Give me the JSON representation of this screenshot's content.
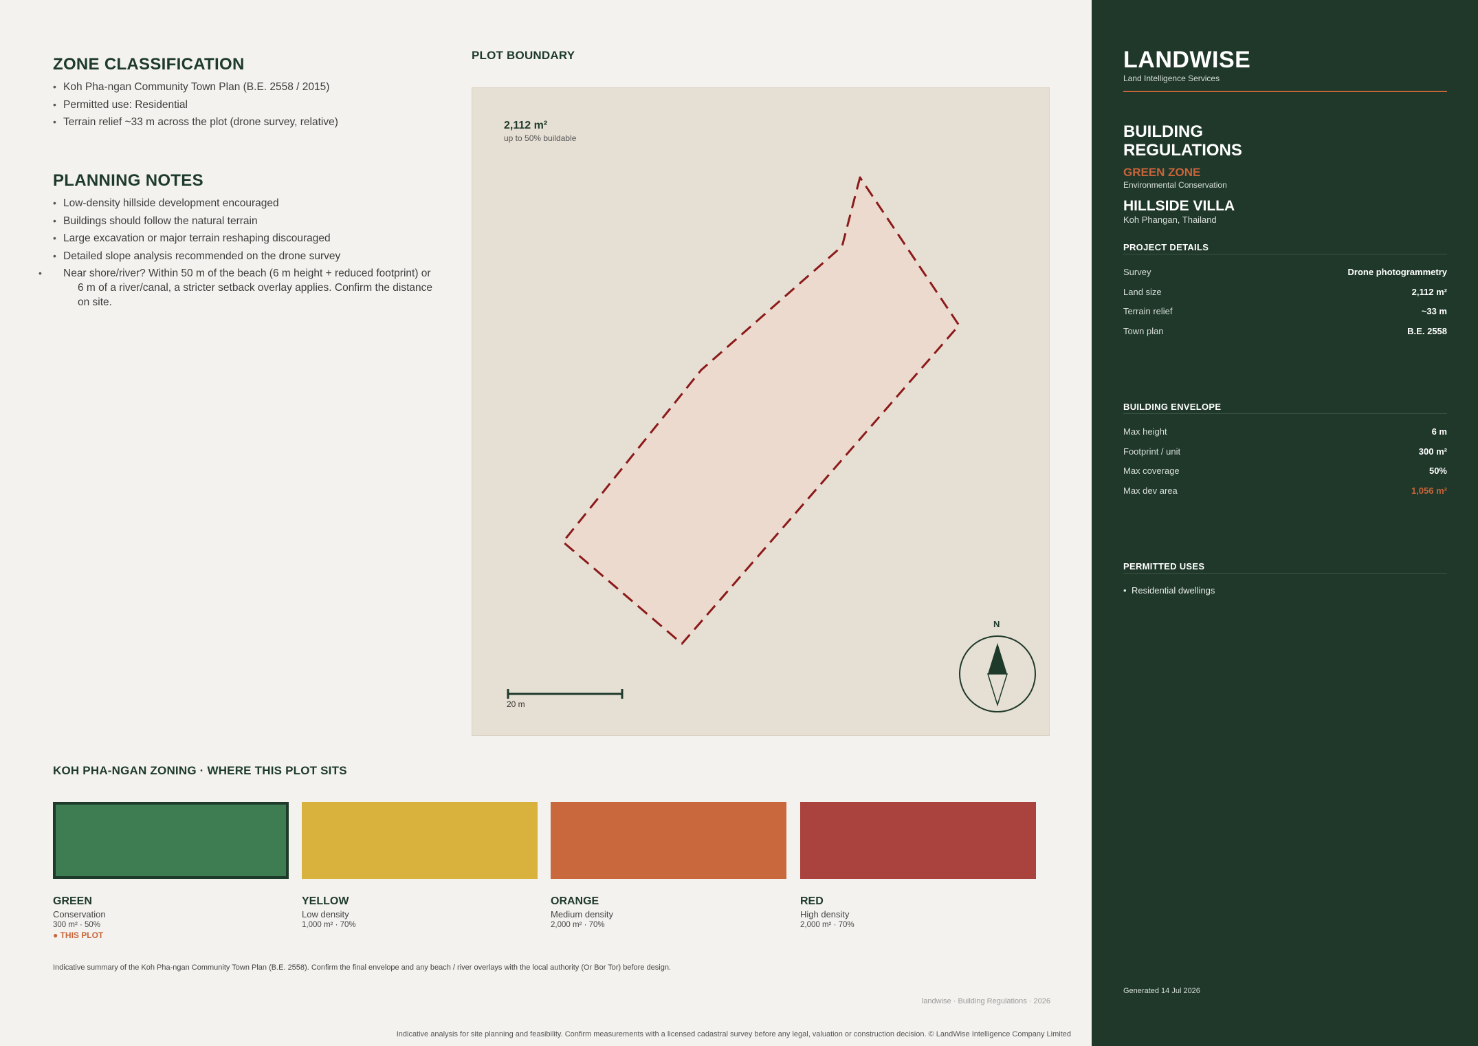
{
  "zone_classification": {
    "title": "ZONE CLASSIFICATION",
    "items": [
      "Koh Pha-ngan Community Town Plan (B.E. 2558 / 2015)",
      "Permitted use: Residential",
      "Terrain relief ~33 m across the plot (drone survey, relative)"
    ]
  },
  "planning_notes": {
    "title": "PLANNING NOTES",
    "items": [
      "Low-density hillside development encouraged",
      "Buildings should follow the natural terrain",
      "Large excavation or major terrain reshaping discouraged",
      "Detailed slope analysis recommended on the drone survey",
      "Near shore/river? Within 50 m of the beach (6 m height + reduced footprint) or 6 m of a river/canal, a stricter setback overlay applies. Confirm the distance on site."
    ]
  },
  "plot": {
    "heading": "PLOT BOUNDARY",
    "area": "2,112 m²",
    "area_sub": "up to 50% buildable",
    "north": "N",
    "scale": "20 m",
    "boundary_color": "#8b1a1a",
    "fill_color": "#ecd9cd"
  },
  "zoning": {
    "heading": "KOH PHA-NGAN ZONING · WHERE THIS PLOT SITS",
    "zones": [
      {
        "name": "GREEN",
        "desc": "Conservation",
        "spec": "300 m² · 50%",
        "tag": "● THIS PLOT",
        "color": "#3e7d52",
        "selected": true
      },
      {
        "name": "YELLOW",
        "desc": "Low density",
        "spec": "1,000 m² · 70%",
        "tag": "",
        "color": "#d8b23c",
        "selected": false
      },
      {
        "name": "ORANGE",
        "desc": "Medium density",
        "spec": "2,000 m² · 70%",
        "tag": "",
        "color": "#c8683c",
        "selected": false
      },
      {
        "name": "RED",
        "desc": "High density",
        "spec": "2,000 m² · 70%",
        "tag": "",
        "color": "#aa423d",
        "selected": false
      }
    ]
  },
  "disclaimer": "Indicative summary of the Koh Pha-ngan Community Town Plan (B.E. 2558). Confirm the final envelope and any beach / river overlays with the local authority (Or Bor Tor) before design.",
  "footer_mark": "landwise · Building Regulations · 2026",
  "legal": "Indicative analysis for site planning and feasibility. Confirm measurements with a licensed cadastral survey before any legal, valuation or construction decision. © LandWise Intelligence Company Limited",
  "sidebar": {
    "brand": "LANDWISE",
    "brand_sub": "Land Intelligence Services",
    "title_line1": "BUILDING",
    "title_line2": "REGULATIONS",
    "zone": "GREEN ZONE",
    "zone_sub": "Environmental Conservation",
    "project": "HILLSIDE VILLA",
    "location": "Koh Phangan, Thailand",
    "project_details": {
      "heading": "PROJECT DETAILS",
      "rows": [
        {
          "k": "Survey",
          "v": "Drone photogrammetry"
        },
        {
          "k": "Land size",
          "v": "2,112 m²"
        },
        {
          "k": "Terrain relief",
          "v": "~33 m"
        },
        {
          "k": "Town plan",
          "v": "B.E. 2558"
        }
      ]
    },
    "building_envelope": {
      "heading": "BUILDING ENVELOPE",
      "rows": [
        {
          "k": "Max height",
          "v": "6 m"
        },
        {
          "k": "Footprint / unit",
          "v": "300 m²"
        },
        {
          "k": "Max coverage",
          "v": "50%"
        },
        {
          "k": "Max dev area",
          "v": "1,056 m²"
        }
      ]
    },
    "permitted_uses": {
      "heading": "PERMITTED USES",
      "items": [
        "Residential dwellings"
      ]
    },
    "generated": "Generated 14 Jul 2026",
    "accent": "#c8643a",
    "background": "#1f382a"
  }
}
